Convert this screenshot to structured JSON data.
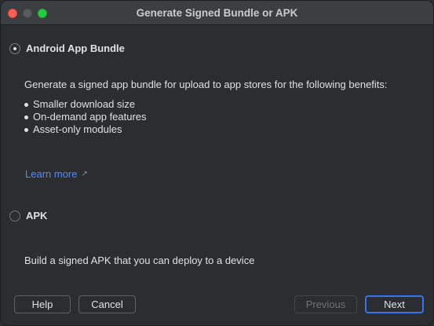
{
  "window": {
    "title": "Generate Signed Bundle or APK"
  },
  "options": {
    "bundle": {
      "label": "Android App Bundle",
      "selected": true,
      "description": "Generate a signed app bundle for upload to app stores for the following benefits:",
      "benefits": [
        "Smaller download size",
        "On-demand app features",
        "Asset-only modules"
      ],
      "learn_more": "Learn more"
    },
    "apk": {
      "label": "APK",
      "selected": false,
      "description": "Build a signed APK that you can deploy to a device"
    }
  },
  "buttons": {
    "help": "Help",
    "cancel": "Cancel",
    "previous": "Previous",
    "next": "Next"
  },
  "icons": {
    "learn_more_arrow": "↗"
  },
  "colors": {
    "link": "#548af7",
    "accent": "#3574f0",
    "background": "#2b2d30"
  }
}
